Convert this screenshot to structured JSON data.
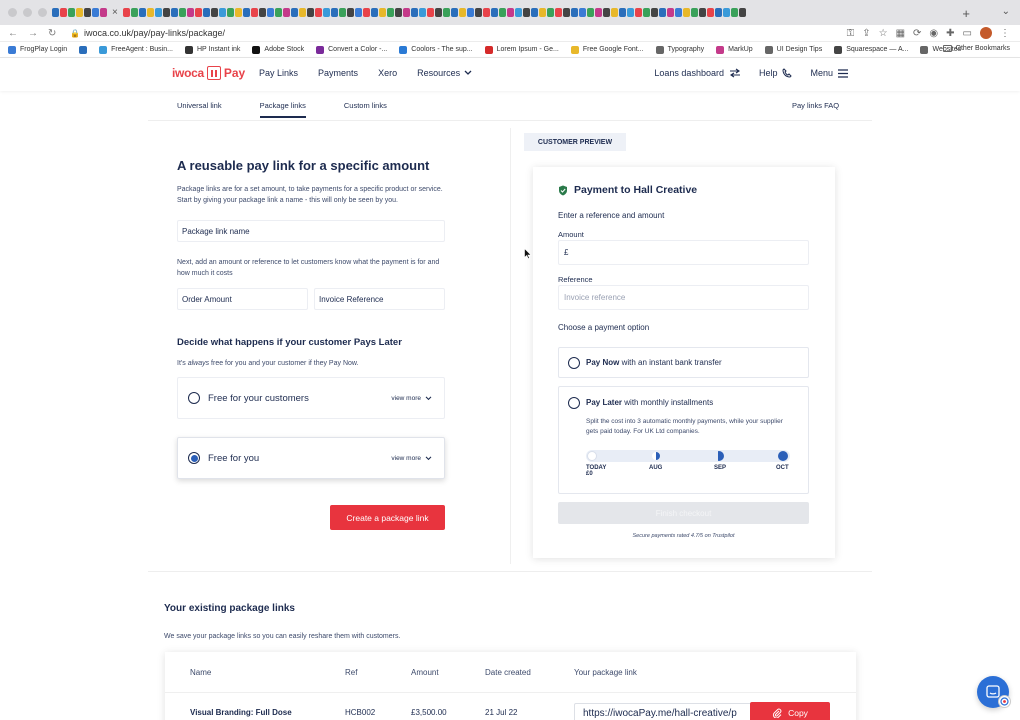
{
  "browser": {
    "active_tab_close": "×",
    "new_tab": "+",
    "tab_menu": "⌄",
    "url": "iwoca.co.uk/pay/pay-links/package/",
    "bookmarks": [
      {
        "label": "FrogPlay Login",
        "color": "#3a7bd5"
      },
      {
        "label": "",
        "color": "#2a6ebb"
      },
      {
        "label": "FreeAgent : Busin...",
        "color": "#3a9ad9"
      },
      {
        "label": "HP Instant ink",
        "color": "#333333"
      },
      {
        "label": "Adobe Stock",
        "color": "#111111"
      },
      {
        "label": "Convert a Color -...",
        "color": "#7a2a9a"
      },
      {
        "label": "Coolors - The sup...",
        "color": "#2a7ad5"
      },
      {
        "label": "Lorem Ipsum - Ge...",
        "color": "#d52a2a"
      },
      {
        "label": "Free Google Font...",
        "color": "#e8b82a"
      },
      {
        "label": "Typography",
        "color": "#666666"
      },
      {
        "label": "MarkUp",
        "color": "#c43a8a"
      },
      {
        "label": "UI Design Tips",
        "color": "#666666"
      },
      {
        "label": "Squarespace — A...",
        "color": "#444444"
      },
      {
        "label": "Websites",
        "color": "#666666"
      }
    ],
    "other_bookmarks": "Other Bookmarks"
  },
  "header": {
    "logo_word": "iwoca",
    "logo_pay": "Pay",
    "nav": [
      "Pay Links",
      "Payments",
      "Xero",
      "Resources"
    ],
    "loans_dashboard": "Loans dashboard",
    "help": "Help",
    "menu": "Menu"
  },
  "subtabs": {
    "items": [
      "Universal link",
      "Package links",
      "Custom links"
    ],
    "active_index": 1,
    "faq": "Pay links FAQ"
  },
  "form": {
    "title": "A reusable pay link for a specific amount",
    "intro": "Package links are for a set amount, to take payments for a specific product or service. Start by giving your package link a name - this will only be seen by you.",
    "name_field": "Package link name",
    "amount_intro": "Next, add an amount or reference to let customers know what the payment is for and how much it costs",
    "order_amount": "Order Amount",
    "invoice_reference": "Invoice Reference",
    "pays_later_title": "Decide what happens if your customer Pays Later",
    "pays_later_pre": "It's",
    "pays_later_em": "always",
    "pays_later_post": "free for you and your customer if they Pay Now.",
    "options": [
      {
        "label": "Free for your customers",
        "view_more": "view more",
        "selected": false
      },
      {
        "label": "Free for you",
        "view_more": "view more",
        "selected": true
      }
    ],
    "create_button": "Create a package link"
  },
  "preview": {
    "tag": "CUSTOMER PREVIEW",
    "title": "Payment to Hall Creative",
    "enter_ref": "Enter a reference and amount",
    "amount_label": "Amount",
    "amount_value": "£",
    "reference_label": "Reference",
    "reference_placeholder": "Invoice reference",
    "choose": "Choose a payment option",
    "pay_now_bold": "Pay Now",
    "pay_now_rest": "with an instant bank transfer",
    "pay_later_bold": "Pay Later",
    "pay_later_rest": "with monthly installments",
    "pay_later_desc": "Split the cost into 3 automatic monthly payments, while your supplier gets paid today. For UK Ltd companies.",
    "timeline": [
      {
        "label": "TODAY",
        "sub": "£0"
      },
      {
        "label": "AUG",
        "sub": ""
      },
      {
        "label": "SEP",
        "sub": ""
      },
      {
        "label": "OCT",
        "sub": ""
      }
    ],
    "finish": "Finish checkout",
    "secure": "Secure payments rated 4.7/5 on Trustpilot"
  },
  "existing": {
    "title": "Your existing package links",
    "subtitle": "We save your package links so you can easily reshare them with customers.",
    "headers": [
      "Name",
      "Ref",
      "Amount",
      "Date created",
      "Your package link"
    ],
    "rows": [
      {
        "name": "Visual Branding: Full Dose",
        "ref": "HCB002",
        "amount": "£3,500.00",
        "date": "21 Jul 22",
        "link": "https://iwocaPay.me/hall-creative/p",
        "copy": "Copy"
      }
    ]
  },
  "colors": {
    "brand_red": "#e8343e",
    "navy": "#1d2b4f",
    "accent_blue": "#2b5fb8",
    "preview_tag_bg": "#eef1f7"
  }
}
